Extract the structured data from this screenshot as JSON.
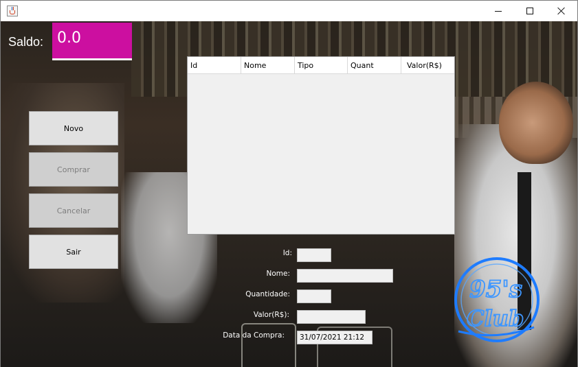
{
  "window": {
    "controls": {
      "minimize": "minimize",
      "maximize": "maximize",
      "close": "close"
    }
  },
  "saldo": {
    "label": "Saldo:",
    "value": "0.0"
  },
  "buttons": [
    {
      "label": "Novo",
      "enabled": true
    },
    {
      "label": "Comprar",
      "enabled": false
    },
    {
      "label": "Cancelar",
      "enabled": false
    },
    {
      "label": "Sair",
      "enabled": true
    }
  ],
  "table": {
    "columns": [
      "Id",
      "Nome",
      "Tipo",
      "Quant",
      "Valor(R$)"
    ],
    "rows": []
  },
  "form": {
    "id": {
      "label": "Id:",
      "value": ""
    },
    "nome": {
      "label": "Nome:",
      "value": ""
    },
    "quantidade": {
      "label": "Quantidade:",
      "value": ""
    },
    "valor": {
      "label": "Valor(R$):",
      "value": ""
    },
    "data_compra": {
      "label": "Data da Compra:",
      "value": "31/07/2021 21:12"
    }
  },
  "logo": {
    "line1": "95's",
    "line2": "Club"
  },
  "colors": {
    "saldo_accent": "#cc0fa0",
    "neon_logo": "#1e7cff"
  }
}
